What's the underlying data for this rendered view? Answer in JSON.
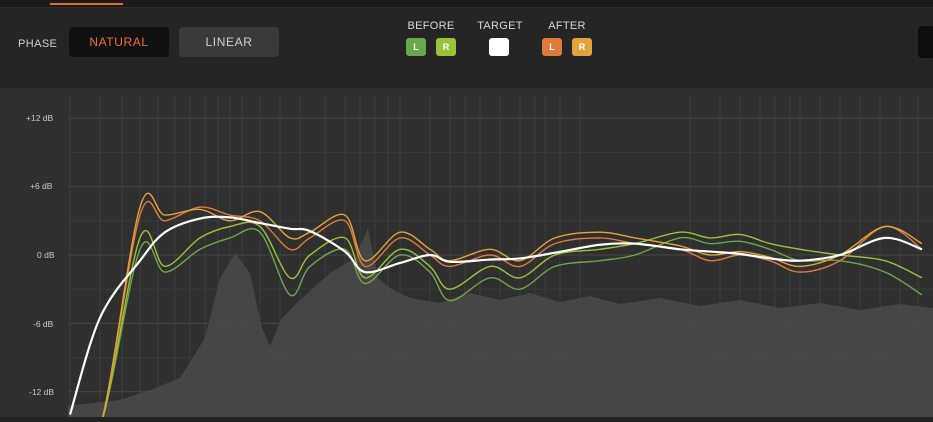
{
  "header": {
    "phase_label": "PHASE",
    "phase_buttons": [
      {
        "label": "NATURAL",
        "selected": true
      },
      {
        "label": "LINEAR",
        "selected": false
      }
    ]
  },
  "legend": {
    "before": {
      "label": "BEFORE",
      "chips": [
        {
          "label": "L",
          "color": "#6aa94b"
        },
        {
          "label": "R",
          "color": "#9ac23a"
        }
      ]
    },
    "target": {
      "label": "TARGET",
      "chips": [
        {
          "label": "",
          "color": "#ffffff"
        }
      ]
    },
    "after": {
      "label": "AFTER",
      "chips": [
        {
          "label": "L",
          "color": "#e07a3a"
        },
        {
          "label": "R",
          "color": "#e0a43a"
        }
      ]
    }
  },
  "colors": {
    "accent": "#e26a34",
    "background": "#232323",
    "plot_background": "#2f2f2f",
    "target": "#ffffff",
    "before_left": "#6aa94b",
    "before_right": "#9ac23a",
    "after_left": "#e07a3a",
    "after_right": "#e0a43a"
  },
  "plot": {
    "y_labels": [
      "+12 dB",
      "+6 dB",
      "0 dB",
      "-6 dB",
      "-12 dB"
    ]
  },
  "chart_data": {
    "type": "line",
    "title": "",
    "xlabel": "",
    "ylabel": "",
    "ylim": [
      -14,
      14
    ],
    "grid": true,
    "y_ticks": [
      12,
      6,
      0,
      -6,
      -12
    ],
    "x": [
      0,
      1,
      2,
      3,
      4,
      5,
      6,
      7,
      8,
      9,
      10,
      11,
      12,
      13,
      14,
      15,
      16,
      17,
      18,
      19,
      20,
      21,
      22,
      23,
      24,
      25,
      26
    ],
    "series": [
      {
        "name": "TARGET",
        "color": "#ffffff",
        "values": [
          -14,
          -5.5,
          -0.5,
          2.0,
          3.2,
          3.3,
          2.8,
          2.3,
          2.1,
          0.3,
          -1.5,
          -0.7,
          0.0,
          -0.6,
          -0.4,
          -0.3,
          0.2,
          0.9,
          1.0,
          0.5,
          0.3,
          0.1,
          -0.3,
          -0.5,
          0.0,
          1.5,
          0.5
        ]
      },
      {
        "name": "BEFORE L",
        "color": "#6aa94b",
        "values": [
          -20,
          -20,
          0.5,
          -1.5,
          0.5,
          1.5,
          2.0,
          -3.5,
          -1.0,
          0.5,
          -2.5,
          0.0,
          -1.5,
          -4.0,
          -2.0,
          -3.0,
          -1.0,
          -0.5,
          0.0,
          1.5,
          1.0,
          1.2,
          0.5,
          -0.5,
          -0.5,
          -1.5,
          -3.5
        ]
      },
      {
        "name": "BEFORE R",
        "color": "#9ac23a",
        "values": [
          -20,
          -20,
          1.5,
          -1.0,
          1.5,
          2.5,
          2.5,
          -2.0,
          0.0,
          1.5,
          -2.0,
          0.5,
          -1.0,
          -3.0,
          -1.0,
          -2.0,
          0.0,
          0.5,
          1.0,
          2.0,
          1.5,
          1.8,
          1.0,
          0.5,
          0.0,
          -0.5,
          -2.0
        ]
      },
      {
        "name": "AFTER L",
        "color": "#e07a3a",
        "values": [
          -20,
          -20,
          3.5,
          3.0,
          4.2,
          3.5,
          3.0,
          0.5,
          1.5,
          3.0,
          -1.0,
          1.5,
          0.0,
          -1.0,
          0.0,
          -1.0,
          1.0,
          1.5,
          1.0,
          0.5,
          -0.5,
          0.0,
          -0.5,
          -1.5,
          -0.5,
          2.5,
          0.5
        ]
      },
      {
        "name": "AFTER R",
        "color": "#e0a43a",
        "values": [
          -20,
          -20,
          4.2,
          3.5,
          4.0,
          3.0,
          3.8,
          1.5,
          2.0,
          3.5,
          -0.5,
          2.0,
          0.5,
          -0.5,
          0.5,
          -0.5,
          1.5,
          2.0,
          1.5,
          0.8,
          0.0,
          0.3,
          -0.2,
          -1.0,
          0.0,
          2.5,
          1.0
        ]
      }
    ]
  }
}
